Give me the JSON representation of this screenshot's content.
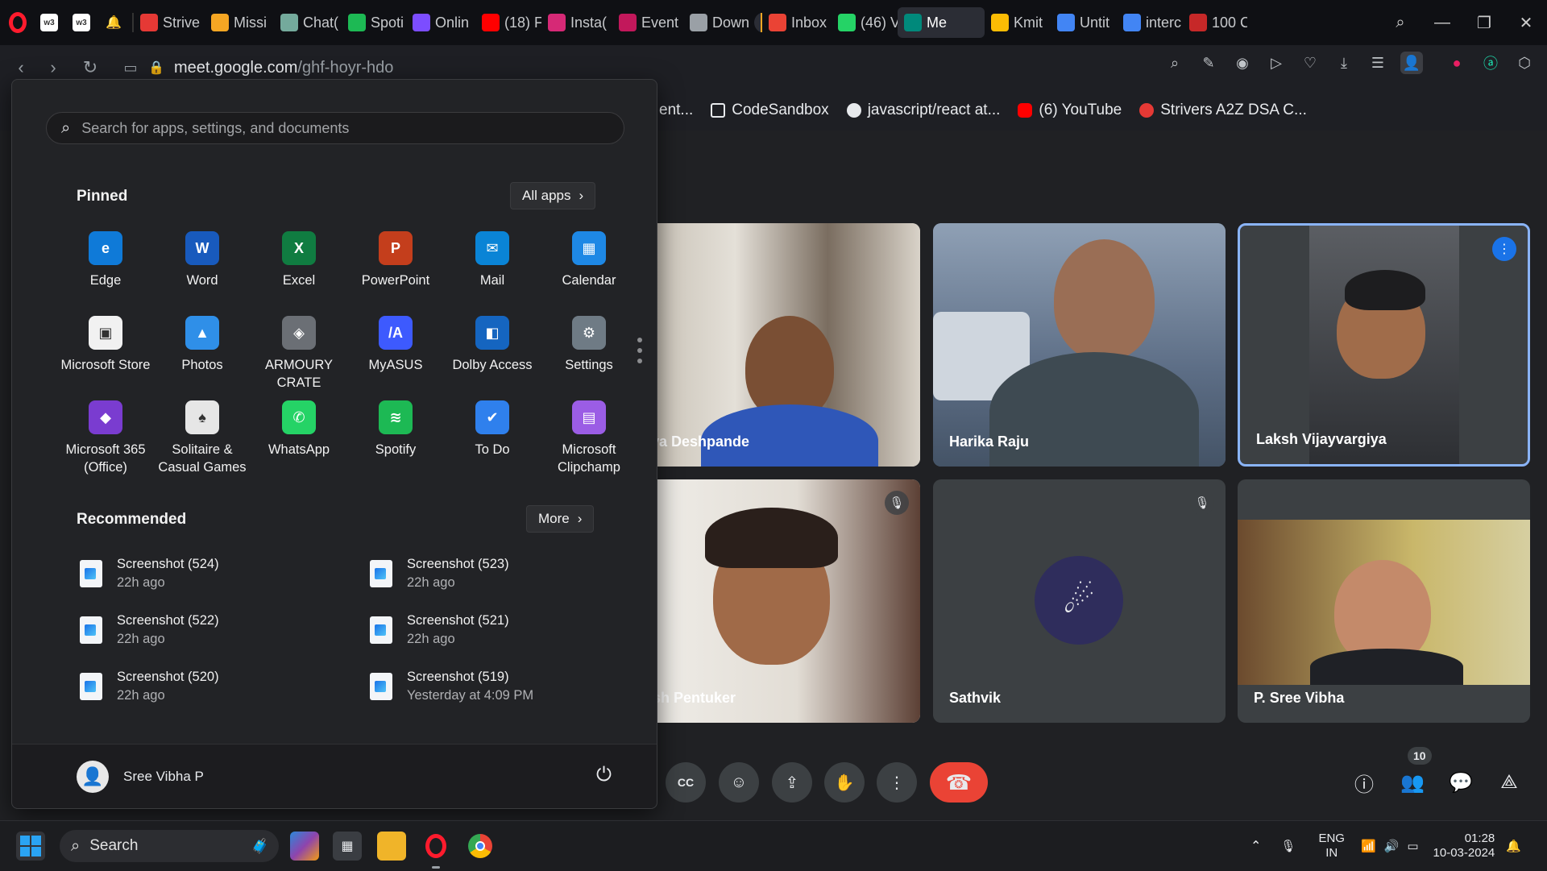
{
  "browser": {
    "tabs": [
      {
        "label": "Strive",
        "icon": "tuf-icon",
        "color": "#e53935"
      },
      {
        "label": "Missi",
        "icon": "bolt-icon",
        "color": "#f5a623"
      },
      {
        "label": "Chat(",
        "icon": "chatgpt-icon",
        "color": "#74aa9c"
      },
      {
        "label": "Spoti",
        "icon": "spotify-icon",
        "color": "#1db954"
      },
      {
        "label": "Onlin",
        "icon": "pen-icon",
        "color": "#7c4dff"
      },
      {
        "label": "(18) F",
        "icon": "youtube-icon",
        "color": "#ff0000"
      },
      {
        "label": "Insta(",
        "icon": "instagram-icon",
        "color": "#d62976"
      },
      {
        "label": "Event",
        "icon": "event-icon",
        "color": "#c2185b"
      },
      {
        "label": "Down",
        "icon": "download-icon",
        "color": "#9aa0a6"
      },
      {
        "label": "Inbox",
        "icon": "gmail-icon",
        "color": "#ea4335"
      },
      {
        "label": "(46) V",
        "icon": "whatsapp-icon",
        "color": "#25d366"
      },
      {
        "label": "Me",
        "icon": "meet-icon",
        "color": "#00897b"
      },
      {
        "label": "Kmit",
        "icon": "drive-icon",
        "color": "#fbbc04"
      },
      {
        "label": "Untit",
        "icon": "docs-icon",
        "color": "#4285f4"
      },
      {
        "label": "interc",
        "icon": "google-icon",
        "color": "#4285f4"
      },
      {
        "label": "100 C",
        "icon": "news-icon",
        "color": "#c62828"
      }
    ],
    "url_host": "meet.google.com",
    "url_path": "/ghf-hoyr-hdo",
    "bookmarks": [
      {
        "label": "ent...",
        "icon": "bookmark-icon"
      },
      {
        "label": "CodeSandbox",
        "icon": "codesandbox-icon"
      },
      {
        "label": "javascript/react at...",
        "icon": "github-icon"
      },
      {
        "label": "(6) YouTube",
        "icon": "youtube-icon"
      },
      {
        "label": "Strivers A2Z DSA C...",
        "icon": "tuf-icon"
      }
    ]
  },
  "start_menu": {
    "search_placeholder": "Search for apps, settings, and documents",
    "pinned_title": "Pinned",
    "all_apps_label": "All apps",
    "pinned": [
      {
        "label": "Edge",
        "icon": "edge-icon",
        "color": "#0f7ad8"
      },
      {
        "label": "Word",
        "icon": "word-icon",
        "color": "#185abd"
      },
      {
        "label": "Excel",
        "icon": "excel-icon",
        "color": "#107c41"
      },
      {
        "label": "PowerPoint",
        "icon": "powerpoint-icon",
        "color": "#c43e1c"
      },
      {
        "label": "Mail",
        "icon": "mail-icon",
        "color": "#0a84d6"
      },
      {
        "label": "Calendar",
        "icon": "calendar-icon",
        "color": "#1e88e5"
      },
      {
        "label": "Microsoft Store",
        "icon": "store-icon",
        "color": "#f1f1f1"
      },
      {
        "label": "Photos",
        "icon": "photos-icon",
        "color": "#2f8fe8"
      },
      {
        "label": "ARMOURY CRATE",
        "icon": "armoury-icon",
        "color": "#6b6f75"
      },
      {
        "label": "MyASUS",
        "icon": "myasus-icon",
        "color": "#3d5afe"
      },
      {
        "label": "Dolby Access",
        "icon": "dolby-icon",
        "color": "#1565c0"
      },
      {
        "label": "Settings",
        "icon": "settings-icon",
        "color": "#6f7b85"
      },
      {
        "label": "Microsoft 365 (Office)",
        "icon": "office-icon",
        "color": "#7a3cd0"
      },
      {
        "label": "Solitaire & Casual Games",
        "icon": "solitaire-icon",
        "color": "#e6e6e6"
      },
      {
        "label": "WhatsApp",
        "icon": "whatsapp-icon",
        "color": "#25d366"
      },
      {
        "label": "Spotify",
        "icon": "spotify-icon",
        "color": "#1db954"
      },
      {
        "label": "To Do",
        "icon": "todo-icon",
        "color": "#2f80ed"
      },
      {
        "label": "Microsoft Clipchamp",
        "icon": "clipchamp-icon",
        "color": "#9b5de5"
      }
    ],
    "recommended_title": "Recommended",
    "more_label": "More",
    "recommended": [
      {
        "name": "Screenshot (524)",
        "time": "22h ago"
      },
      {
        "name": "Screenshot (523)",
        "time": "22h ago"
      },
      {
        "name": "Screenshot (522)",
        "time": "22h ago"
      },
      {
        "name": "Screenshot (521)",
        "time": "22h ago"
      },
      {
        "name": "Screenshot (520)",
        "time": "22h ago"
      },
      {
        "name": "Screenshot (519)",
        "time": "Yesterday at 4:09 PM"
      }
    ],
    "user_name": "Sree Vibha P"
  },
  "meet": {
    "participants": [
      {
        "name": "harva Deshpande",
        "muted": false
      },
      {
        "name": "Harika Raju",
        "muted": false
      },
      {
        "name": "Laksh Vijayvargiya",
        "muted": false,
        "speaking": true
      },
      {
        "name": "ailesh Pentuker",
        "muted": true
      },
      {
        "name": "Sathvik",
        "muted": true
      },
      {
        "name": "P. Sree Vibha",
        "muted": false
      }
    ],
    "people_count": "10"
  },
  "taskbar": {
    "search_label": "Search",
    "lang_top": "ENG",
    "lang_bottom": "IN",
    "time": "01:28",
    "date": "10-03-2024"
  },
  "colors": {
    "meet_bg": "#202124",
    "end_call": "#ea4335",
    "speaking_border": "#8ab4f8",
    "start_bg": "#222326"
  }
}
